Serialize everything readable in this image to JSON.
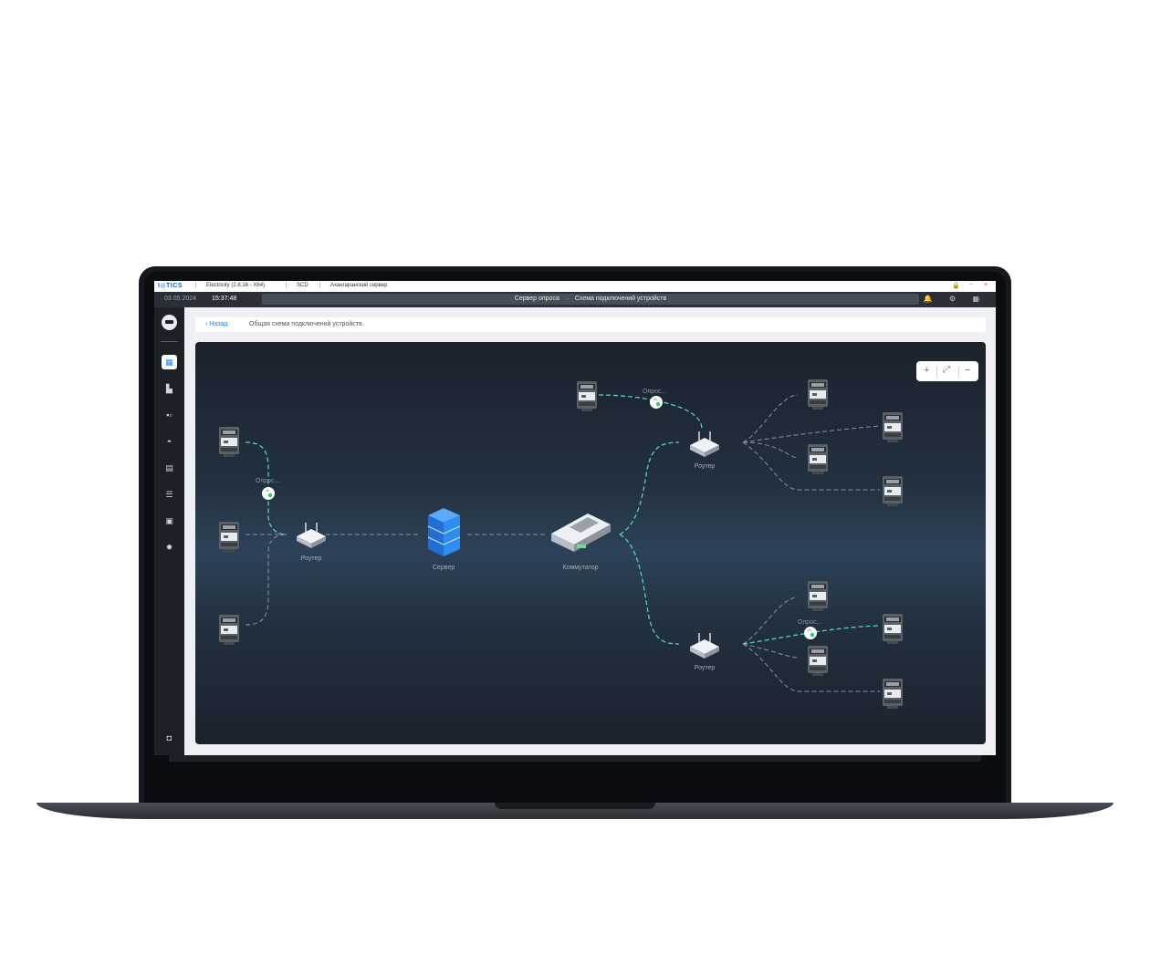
{
  "titlebar": {
    "logo": "I◎TICS",
    "app": "Electricity (2.8.16 - X64)",
    "module": "SCD",
    "server": "Ахангаранский сервер",
    "sep": "|"
  },
  "statusbar": {
    "date": "03.05.2024",
    "time": "15:37:48",
    "crumb_from": "Сервер опроса",
    "crumb_arrow": "→",
    "crumb_to": "Схема подключений устройств",
    "icons": "🔔 ⚙ ▦"
  },
  "sidebar": {
    "items": [
      "calendar-icon",
      "document-icon",
      "grid-icon",
      "gauge-icon",
      "report-icon",
      "list-icon",
      "inbox-icon",
      "settings-icon"
    ],
    "user_icon": "user-icon"
  },
  "header": {
    "back_label": "Назад",
    "title": "Общая схема подключений устройств"
  },
  "zoom": {
    "plus": "+",
    "fit": "⤢",
    "minus": "−"
  },
  "diagram": {
    "router_label": "Роутер",
    "server_label": "Сервер",
    "switch_label": "Коммутатор",
    "poll_label": "Опрос...",
    "accent_color": "#4fd6b4",
    "server_color": "#2e8ef0"
  }
}
